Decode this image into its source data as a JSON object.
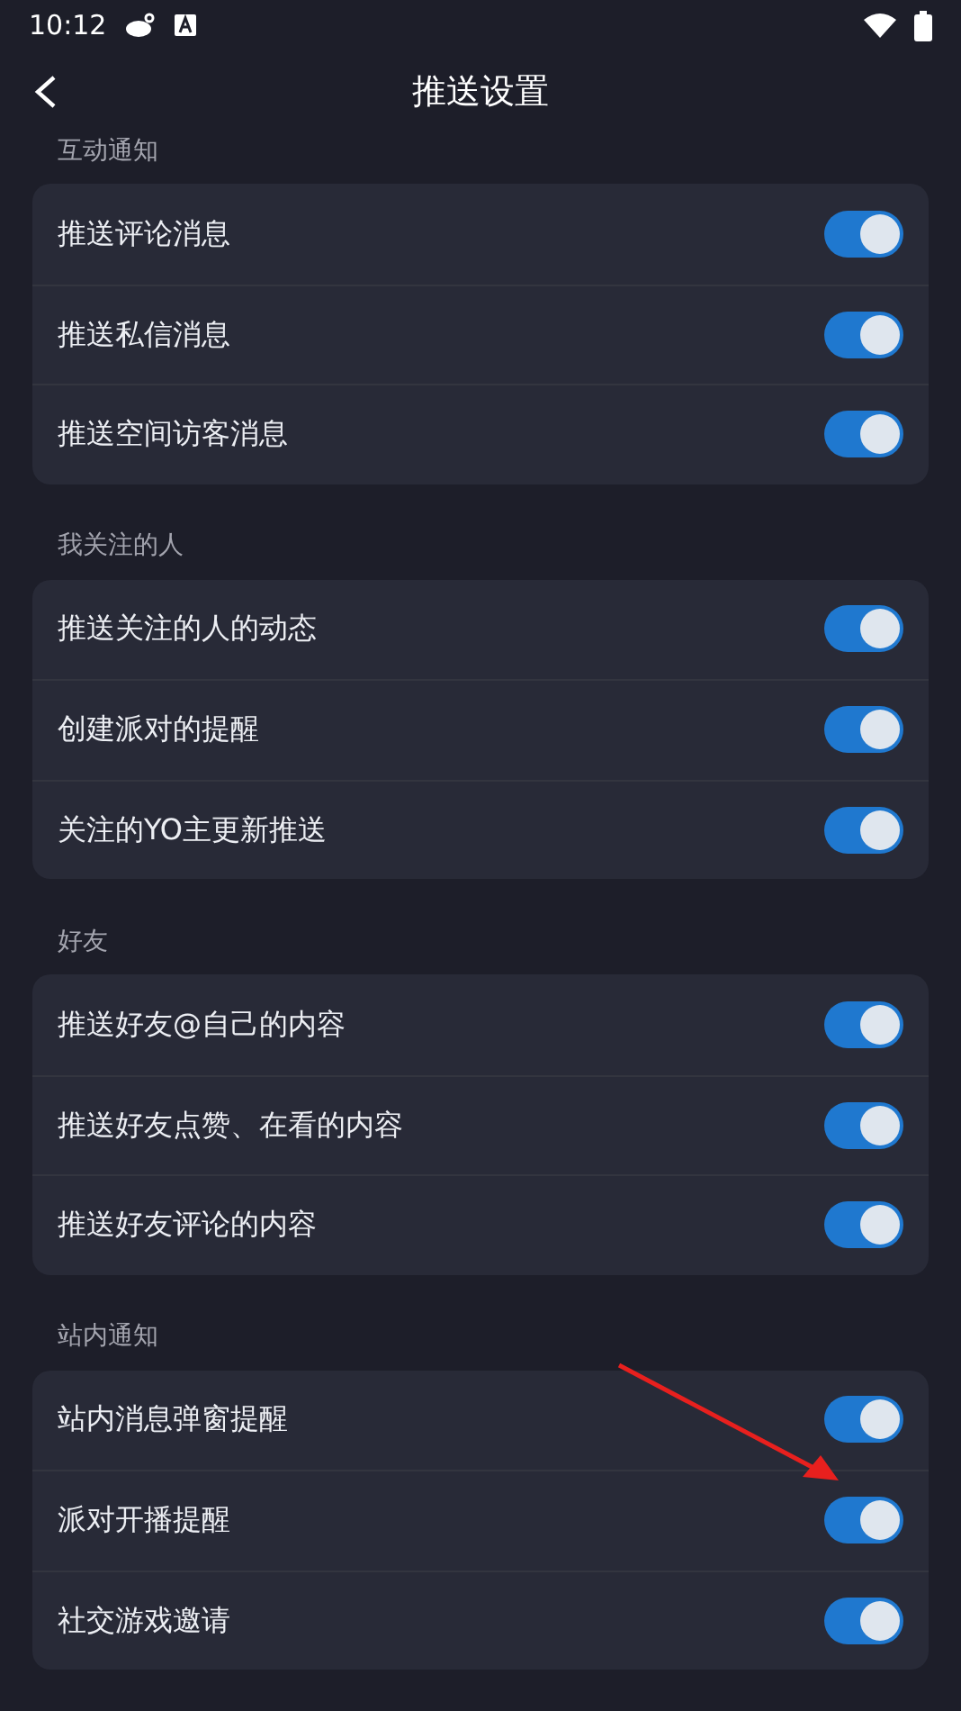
{
  "status_bar": {
    "time": "10:12"
  },
  "header": {
    "title": "推送设置"
  },
  "sections": [
    {
      "title": "互动通知",
      "items": [
        {
          "label": "推送评论消息",
          "on": true
        },
        {
          "label": "推送私信消息",
          "on": true
        },
        {
          "label": "推送空间访客消息",
          "on": true
        }
      ]
    },
    {
      "title": "我关注的人",
      "items": [
        {
          "label": "推送关注的人的动态",
          "on": true
        },
        {
          "label": "创建派对的提醒",
          "on": true
        },
        {
          "label": "关注的YO主更新推送",
          "on": true
        }
      ]
    },
    {
      "title": "好友",
      "items": [
        {
          "label": "推送好友@自己的内容",
          "on": true
        },
        {
          "label": "推送好友点赞、在看的内容",
          "on": true
        },
        {
          "label": "推送好友评论的内容",
          "on": true
        }
      ]
    },
    {
      "title": "站内通知",
      "items": [
        {
          "label": "站内消息弹窗提醒",
          "on": true
        },
        {
          "label": "派对开播提醒",
          "on": true
        },
        {
          "label": "社交游戏邀请",
          "on": true
        }
      ]
    }
  ]
}
